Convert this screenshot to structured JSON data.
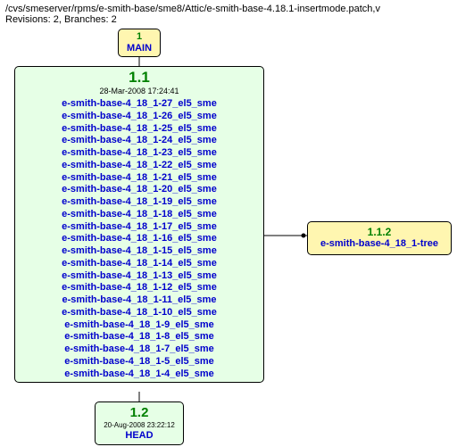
{
  "header": {
    "path": "/cvs/smeserver/rpms/e-smith-base/sme8/Attic/e-smith-base-4.18.1-insertmode.patch,v",
    "revinfo": "Revisions: 2, Branches: 2"
  },
  "main_box": {
    "num": "1",
    "label": "MAIN"
  },
  "big_box": {
    "version": "1.1",
    "timestamp": "28-Mar-2008 17:24:41",
    "tags": [
      "e-smith-base-4_18_1-27_el5_sme",
      "e-smith-base-4_18_1-26_el5_sme",
      "e-smith-base-4_18_1-25_el5_sme",
      "e-smith-base-4_18_1-24_el5_sme",
      "e-smith-base-4_18_1-23_el5_sme",
      "e-smith-base-4_18_1-22_el5_sme",
      "e-smith-base-4_18_1-21_el5_sme",
      "e-smith-base-4_18_1-20_el5_sme",
      "e-smith-base-4_18_1-19_el5_sme",
      "e-smith-base-4_18_1-18_el5_sme",
      "e-smith-base-4_18_1-17_el5_sme",
      "e-smith-base-4_18_1-16_el5_sme",
      "e-smith-base-4_18_1-15_el5_sme",
      "e-smith-base-4_18_1-14_el5_sme",
      "e-smith-base-4_18_1-13_el5_sme",
      "e-smith-base-4_18_1-12_el5_sme",
      "e-smith-base-4_18_1-11_el5_sme",
      "e-smith-base-4_18_1-10_el5_sme",
      "e-smith-base-4_18_1-9_el5_sme",
      "e-smith-base-4_18_1-8_el5_sme",
      "e-smith-base-4_18_1-7_el5_sme",
      "e-smith-base-4_18_1-5_el5_sme",
      "e-smith-base-4_18_1-4_el5_sme"
    ]
  },
  "bottom_box": {
    "version": "1.2",
    "timestamp": "20-Aug-2008 23:22:12",
    "label": "HEAD"
  },
  "branch_box": {
    "version": "1.1.2",
    "label": "e-smith-base-4_18_1-tree"
  }
}
